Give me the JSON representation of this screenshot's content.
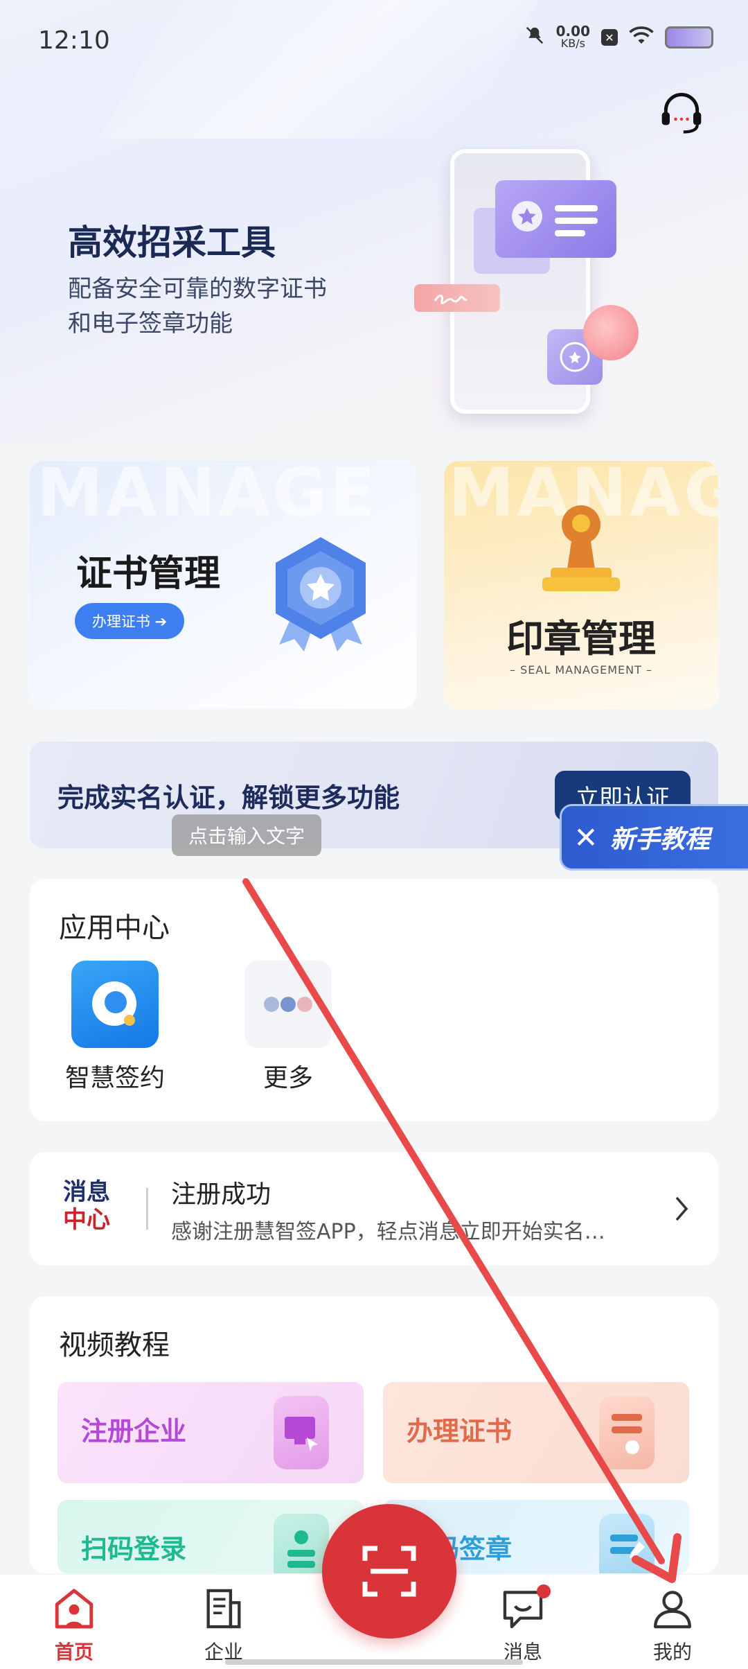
{
  "status_bar": {
    "time": "12:10",
    "speed_value": "0.00",
    "speed_unit": "KB/s"
  },
  "hero": {
    "title": "高效招采工具",
    "subtitle_line1": "配备安全可靠的数字证书",
    "subtitle_line2": "和电子签章功能"
  },
  "cards": {
    "certificate": {
      "bg_word": "MANAGE",
      "title": "证书管理",
      "button": "办理证书 ➔"
    },
    "seal": {
      "bg_word": "MANAG",
      "title": "印章管理",
      "subtitle": "– SEAL MANAGEMENT –"
    }
  },
  "banner": {
    "text": "完成实名认证，解锁更多功能",
    "button": "立即认证"
  },
  "tooltip": "点击输入文字",
  "tutorial": {
    "close": "✕",
    "label": "新手教程",
    "chevrons": "›››"
  },
  "apps": {
    "title": "应用中心",
    "items": [
      {
        "label": "智慧签约"
      },
      {
        "label": "更多"
      }
    ]
  },
  "message": {
    "logo_line1": "消息",
    "logo_line2": "中心",
    "title": "注册成功",
    "body": "感谢注册慧智签APP，轻点消息立即开始实名…"
  },
  "videos": {
    "title": "视频教程",
    "items": [
      {
        "label": "注册企业",
        "color": "#b449d8"
      },
      {
        "label": "办理证书",
        "color": "#e06a4a"
      },
      {
        "label": "扫码登录",
        "color": "#1fb98f"
      },
      {
        "label": "扫码签章",
        "color": "#2e9fd8"
      }
    ]
  },
  "nav": {
    "items": [
      {
        "label": "首页"
      },
      {
        "label": "企业"
      },
      {
        "label": "消息"
      },
      {
        "label": "我的"
      }
    ],
    "active_color": "#d9343a"
  }
}
